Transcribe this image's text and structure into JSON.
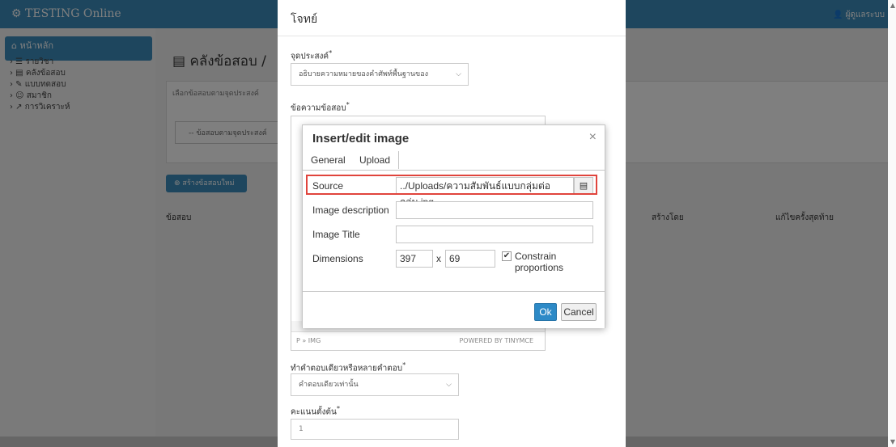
{
  "app": {
    "brand": "TESTING Online",
    "user": "ผู้ดูแลระบบ"
  },
  "sidebar": {
    "home": "หน้าหลัก",
    "items": [
      {
        "label": "รายวิชา"
      },
      {
        "label": "คลังข้อสอบ"
      },
      {
        "label": "แบบทดสอบ"
      },
      {
        "label": "สมาชิก"
      },
      {
        "label": "การวิเคราะห์"
      }
    ]
  },
  "main": {
    "title": "คลังข้อสอบ /",
    "subtext": "เลือกข้อสอบตามจุดประสงค์",
    "filter_select": "-- ข้อสอบตามจุดประสงค์",
    "create_button": "สร้างข้อสอบใหม่",
    "columns": [
      "ข้อสอบ",
      "สร้างโดย",
      "แก้ไขครั้งสุดท้าย"
    ]
  },
  "modal": {
    "title": "โจทย์",
    "objective_label": "จุดประสงค์",
    "objective_value": "อธิบายความหมายของคำศัพท์พื้นฐานของ",
    "question_label": "ข้อความข้อสอบ",
    "editor_path": "P » IMG",
    "editor_powered": "POWERED BY TINYMCE",
    "answer_type_label": "ทำคำตอบเดียวหรือหลายคำตอบ",
    "answer_type_value": "คำตอบเดียวเท่านั้น",
    "score_label": "คะแนนตั้งต้น",
    "score_value": "1"
  },
  "dialog": {
    "title": "Insert/edit image",
    "close": "×",
    "tabs": [
      "General",
      "Upload"
    ],
    "source_label": "Source",
    "source_value": "../Uploads/ความสัมพันธ์แบบกลุ่มต่อกลุ่ม.jpg",
    "description_label": "Image description",
    "description_value": "",
    "image_title_label": "Image Title",
    "image_title_value": "",
    "dimensions_label": "Dimensions",
    "width": "397",
    "height": "69",
    "x_separator": "x",
    "constrain_label": "Constrain proportions",
    "constrain_checked": true,
    "ok": "Ok",
    "cancel": "Cancel"
  },
  "colors": {
    "primary": "#3c8dbc",
    "ok_button": "#2d8ac7",
    "highlight": "#e0443c"
  }
}
